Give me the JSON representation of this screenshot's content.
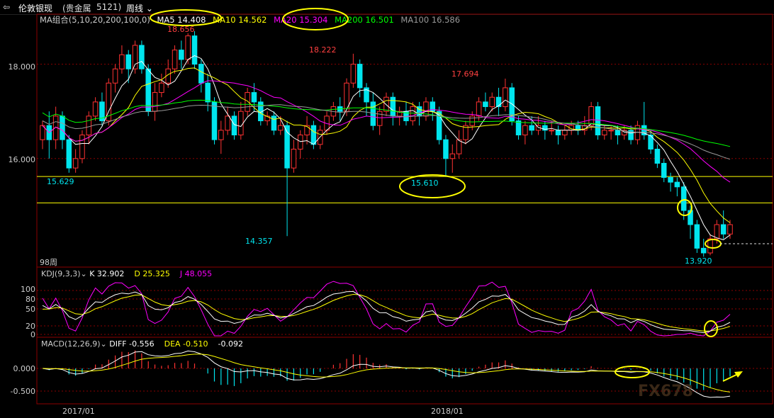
{
  "header": {
    "back_icon": "back-arrow-icon",
    "symbol_name": "伦敦银现",
    "category": "(贵金属",
    "code": "5121)",
    "period": "周线"
  },
  "ma_legend": {
    "title": "MA组合(5,10,20,200,100,0)",
    "items": [
      {
        "label": "MA5 14.408",
        "color": "#ffffff"
      },
      {
        "label": "MA10 14.562",
        "color": "#ffff00"
      },
      {
        "label": "MA20 15.304",
        "color": "#ff00ff"
      },
      {
        "label": "MA200 16.501",
        "color": "#00ff00"
      },
      {
        "label": "MA100 16.586",
        "color": "#999999"
      }
    ]
  },
  "price_axis": [
    "18.000",
    "16.000"
  ],
  "price_annotations": {
    "high1": "18.656",
    "high2": "18.222",
    "high3": "17.694",
    "low1": "15.629",
    "low2": "14.357",
    "low3": "15.610",
    "low4": "13.920"
  },
  "week_count": "98周",
  "kdj": {
    "title": "KDJ(9,3,3)",
    "k": "K 32.902",
    "d": "D 25.325",
    "j": "J 48.055",
    "axis": [
      "100",
      "80",
      "50",
      "20",
      "0"
    ]
  },
  "macd": {
    "title": "MACD(12,26,9)",
    "diff": "DIFF -0.556",
    "dea": "DEA -0.510",
    "macd": "-0.092",
    "axis": [
      "0.000",
      "-0.500"
    ]
  },
  "date_axis": [
    "2017/01",
    "2018/01"
  ],
  "watermark": "FX678",
  "colors": {
    "up": "#ff3232",
    "down": "#00e5ee",
    "grid": "#8b0000",
    "annotation": "#ffff00"
  },
  "chart_data": {
    "type": "candlestick",
    "title": "伦敦银现 周线",
    "ylim": [
      13.7,
      19.0
    ],
    "candles": [
      [
        16.4,
        16.7,
        16.2,
        16.8
      ],
      [
        16.7,
        16.4,
        16.0,
        17.0
      ],
      [
        16.4,
        16.9,
        16.2,
        17.1
      ],
      [
        16.9,
        16.4,
        16.2,
        17.0
      ],
      [
        16.4,
        15.8,
        15.7,
        16.5
      ],
      [
        15.8,
        16.0,
        15.7,
        16.2
      ],
      [
        16.0,
        16.5,
        15.9,
        16.6
      ],
      [
        16.5,
        16.9,
        16.3,
        17.0
      ],
      [
        16.9,
        17.2,
        16.8,
        17.3
      ],
      [
        17.2,
        16.8,
        16.7,
        17.4
      ],
      [
        16.8,
        17.6,
        16.7,
        17.7
      ],
      [
        17.6,
        17.9,
        17.4,
        18.0
      ],
      [
        17.9,
        18.2,
        17.8,
        18.4
      ],
      [
        18.2,
        17.9,
        17.6,
        18.3
      ],
      [
        17.9,
        18.4,
        17.8,
        18.5
      ],
      [
        18.4,
        17.9,
        17.8,
        18.5
      ],
      [
        17.9,
        17.0,
        16.9,
        18.0
      ],
      [
        17.0,
        17.4,
        16.8,
        17.6
      ],
      [
        17.4,
        17.6,
        17.3,
        17.8
      ],
      [
        17.6,
        17.9,
        17.5,
        18.1
      ],
      [
        17.9,
        18.3,
        17.8,
        18.4
      ],
      [
        18.3,
        18.1,
        17.9,
        18.5
      ],
      [
        18.1,
        18.6,
        18.0,
        18.656
      ],
      [
        18.6,
        18.0,
        17.9,
        18.7
      ],
      [
        18.0,
        17.6,
        17.4,
        18.1
      ],
      [
        17.6,
        17.2,
        17.0,
        17.8
      ],
      [
        17.2,
        16.4,
        16.3,
        17.3
      ],
      [
        16.4,
        16.6,
        16.1,
        16.8
      ],
      [
        16.6,
        16.9,
        16.5,
        17.1
      ],
      [
        16.9,
        16.5,
        16.4,
        17.0
      ],
      [
        16.5,
        17.0,
        16.4,
        17.2
      ],
      [
        17.0,
        17.4,
        16.9,
        17.5
      ],
      [
        17.4,
        17.2,
        17.0,
        17.6
      ],
      [
        17.2,
        16.8,
        16.7,
        17.3
      ],
      [
        16.8,
        16.9,
        16.7,
        17.0
      ],
      [
        16.9,
        16.6,
        16.5,
        17.0
      ],
      [
        16.6,
        16.7,
        16.5,
        16.9
      ],
      [
        16.7,
        15.8,
        14.357,
        16.8
      ],
      [
        15.8,
        16.2,
        15.7,
        16.4
      ],
      [
        16.2,
        16.5,
        16.0,
        16.6
      ],
      [
        16.5,
        16.7,
        16.3,
        16.9
      ],
      [
        16.7,
        16.3,
        16.2,
        16.8
      ],
      [
        16.3,
        16.6,
        16.2,
        16.7
      ],
      [
        16.6,
        16.9,
        16.5,
        17.0
      ],
      [
        16.9,
        17.1,
        16.8,
        17.2
      ],
      [
        17.1,
        17.0,
        16.8,
        17.3
      ],
      [
        17.0,
        17.6,
        16.9,
        17.7
      ],
      [
        17.6,
        18.0,
        17.5,
        18.222
      ],
      [
        18.0,
        17.5,
        17.3,
        18.1
      ],
      [
        17.5,
        17.2,
        16.9,
        17.6
      ],
      [
        17.2,
        16.7,
        16.6,
        17.4
      ],
      [
        16.7,
        17.0,
        16.5,
        17.1
      ],
      [
        17.0,
        17.3,
        16.9,
        17.4
      ],
      [
        17.3,
        16.9,
        16.7,
        17.4
      ],
      [
        16.9,
        17.0,
        16.7,
        17.1
      ],
      [
        17.0,
        16.8,
        16.7,
        17.2
      ],
      [
        16.8,
        17.1,
        16.7,
        17.2
      ],
      [
        17.1,
        16.9,
        16.7,
        17.2
      ],
      [
        16.9,
        17.2,
        16.8,
        17.3
      ],
      [
        17.2,
        17.0,
        16.8,
        17.3
      ],
      [
        17.0,
        16.4,
        16.3,
        17.1
      ],
      [
        16.4,
        16.0,
        15.61,
        16.5
      ],
      [
        16.0,
        16.1,
        15.7,
        16.3
      ],
      [
        16.1,
        16.4,
        16.0,
        16.6
      ],
      [
        16.4,
        16.7,
        16.3,
        16.8
      ],
      [
        16.7,
        16.9,
        16.6,
        17.0
      ],
      [
        16.9,
        17.2,
        16.8,
        17.3
      ],
      [
        17.2,
        17.1,
        17.0,
        17.4
      ],
      [
        17.1,
        17.3,
        17.0,
        17.4
      ],
      [
        17.3,
        17.1,
        16.9,
        17.5
      ],
      [
        17.1,
        17.5,
        17.0,
        17.694
      ],
      [
        17.5,
        16.8,
        16.7,
        17.6
      ],
      [
        16.8,
        16.5,
        16.4,
        16.9
      ],
      [
        16.5,
        16.7,
        16.3,
        16.8
      ],
      [
        16.7,
        16.6,
        16.5,
        16.9
      ],
      [
        16.6,
        16.7,
        16.5,
        16.9
      ],
      [
        16.7,
        16.6,
        16.4,
        16.8
      ],
      [
        16.6,
        16.6,
        16.5,
        16.8
      ],
      [
        16.6,
        16.5,
        16.3,
        16.7
      ],
      [
        16.5,
        16.6,
        16.4,
        16.7
      ],
      [
        16.6,
        16.7,
        16.5,
        16.8
      ],
      [
        16.7,
        16.6,
        16.5,
        16.8
      ],
      [
        16.6,
        16.7,
        16.5,
        16.9
      ],
      [
        16.7,
        17.1,
        16.6,
        17.2
      ],
      [
        17.1,
        16.5,
        16.4,
        17.2
      ],
      [
        16.5,
        16.6,
        16.4,
        16.7
      ],
      [
        16.6,
        16.6,
        16.4,
        16.7
      ],
      [
        16.6,
        16.5,
        16.3,
        16.7
      ],
      [
        16.5,
        16.6,
        16.4,
        16.7
      ],
      [
        16.6,
        16.4,
        16.3,
        16.7
      ],
      [
        16.4,
        16.7,
        16.3,
        16.8
      ],
      [
        16.7,
        16.5,
        16.4,
        17.2
      ],
      [
        16.5,
        16.2,
        16.1,
        16.6
      ],
      [
        16.2,
        15.9,
        15.8,
        16.3
      ],
      [
        15.9,
        15.6,
        15.5,
        16.0
      ],
      [
        15.6,
        15.5,
        15.3,
        15.7
      ],
      [
        15.5,
        15.4,
        15.2,
        15.6
      ],
      [
        15.4,
        14.9,
        14.7,
        15.5
      ],
      [
        14.9,
        14.6,
        14.3,
        15.0
      ],
      [
        14.6,
        14.1,
        14.0,
        14.7
      ],
      [
        14.1,
        14.0,
        13.92,
        14.3
      ],
      [
        14.0,
        14.3,
        13.95,
        14.4
      ],
      [
        14.3,
        14.6,
        14.2,
        14.7
      ],
      [
        14.6,
        14.4,
        14.3,
        14.9
      ],
      [
        14.4,
        14.6,
        14.3,
        14.7
      ]
    ]
  }
}
